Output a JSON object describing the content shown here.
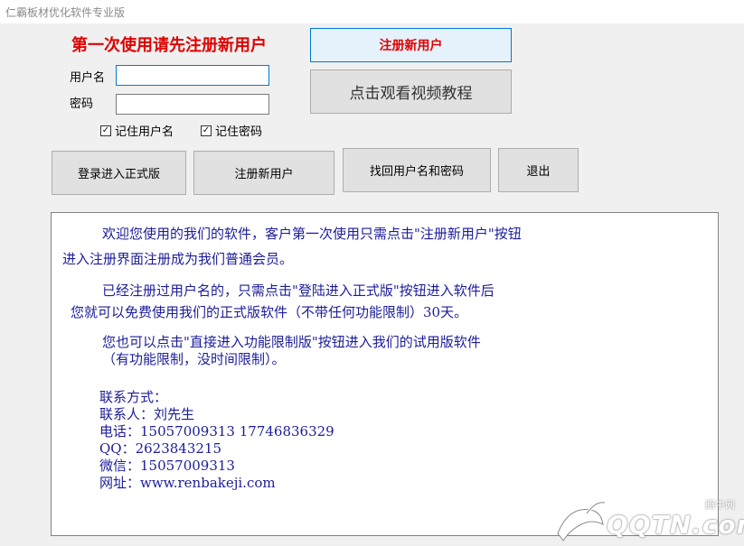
{
  "window": {
    "title": "仁霸板材优化软件专业版"
  },
  "login": {
    "heading": "第一次使用请先注册新用户",
    "username_label": "用户名",
    "username_value": "",
    "password_label": "密码",
    "password_value": "",
    "remember_username": {
      "label": "记住用户名",
      "checked": true
    },
    "remember_password": {
      "label": "记住密码",
      "checked": true
    }
  },
  "top_buttons": {
    "register": "注册新用户",
    "tutorial": "点击观看视频教程"
  },
  "action_buttons": {
    "login": "登录进入正式版",
    "register": "注册新用户",
    "recover": "找回用户名和密码",
    "exit": "退出"
  },
  "info": {
    "p1_line1": "欢迎您使用的我们的软件，客户第一次使用只需点击\"注册新用户\"按钮",
    "p1_line2": "进入注册界面注册成为我们普通会员。",
    "p2_line1": "已经注册过用户名的，只需点击\"登陆进入正式版\"按钮进入软件后",
    "p2_line2": "您就可以免费使用我们的正式版软件（不带任何功能限制）30天。",
    "p3_line1": "您也可以点击\"直接进入功能限制版\"按钮进入我们的试用版软件",
    "p3_line2": "（有功能限制，没时间限制）。",
    "contact_heading": "联系方式：",
    "contact_person": "联系人：刘先生",
    "phone": "电话：15057009313 17746836329",
    "qq": "QQ：2623843215",
    "wechat": "微信：15057009313",
    "website": "网址：www.renbakeji.com"
  },
  "watermark": {
    "text": "QQTN.com",
    "small": "腾牛网"
  },
  "colors": {
    "heading": "#e00000",
    "info_text": "#1c1c9a",
    "focus_border": "#0078d7"
  }
}
